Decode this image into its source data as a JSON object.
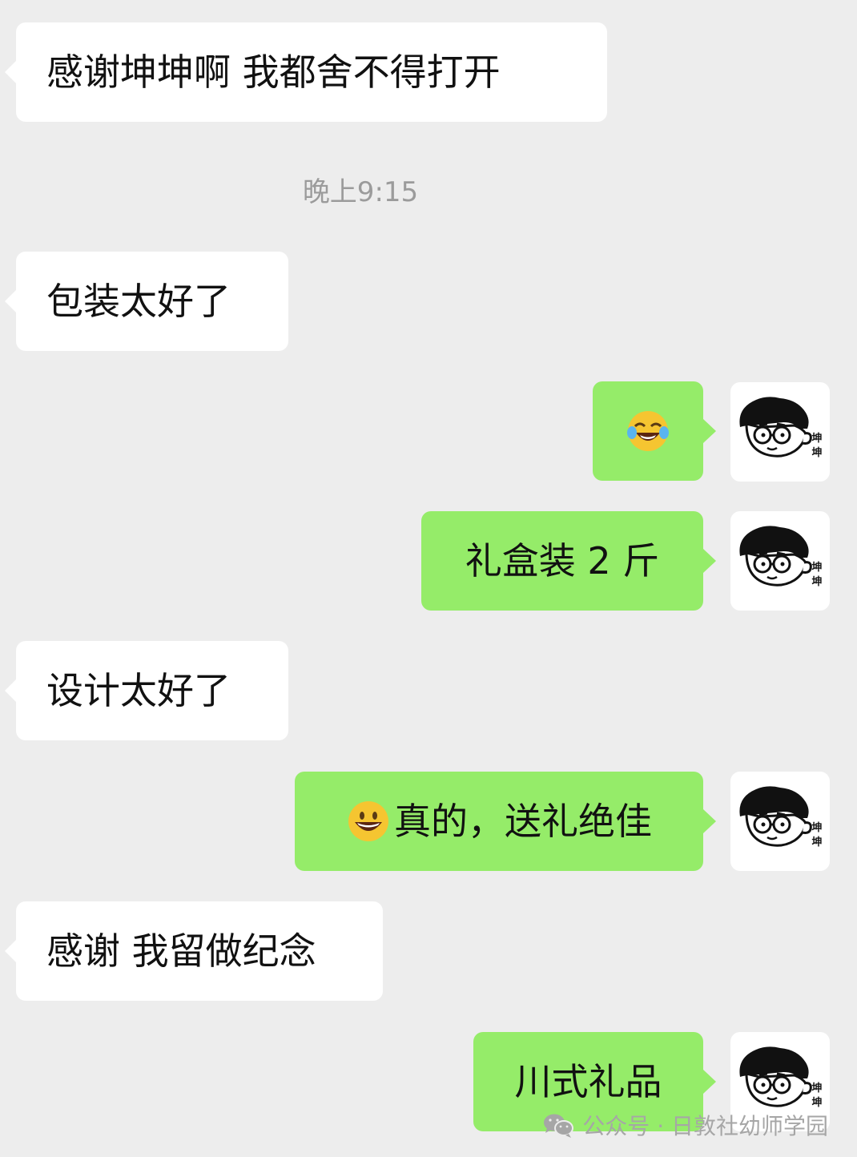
{
  "timestamp": "晚上9:15",
  "messages": [
    {
      "side": "left",
      "text": "感谢坤坤啊 我都舍不得打开"
    },
    {
      "side": "left",
      "text": "包装太好了"
    },
    {
      "side": "right",
      "emoji": "laughing-tears-emoji",
      "text": ""
    },
    {
      "side": "right",
      "text": "礼盒装 2 斤"
    },
    {
      "side": "left",
      "text": "设计太好了"
    },
    {
      "side": "right",
      "emoji": "grinning-emoji",
      "text": "真的，送礼绝佳"
    },
    {
      "side": "left",
      "text": "感谢 我留做纪念"
    },
    {
      "side": "right",
      "text": "川式礼品"
    }
  ],
  "watermark": {
    "icon": "wechat-icon",
    "text": "公众号 · 日敦社幼师学园"
  },
  "colors": {
    "background": "#ededed",
    "incoming_bubble": "#ffffff",
    "outgoing_bubble": "#95ec69",
    "timestamp_text": "#9b9b9b",
    "watermark_text": "#a6a6a6"
  },
  "avatar": {
    "icon": "cartoon-avatar-icon",
    "glyph_text": "坤坤"
  }
}
